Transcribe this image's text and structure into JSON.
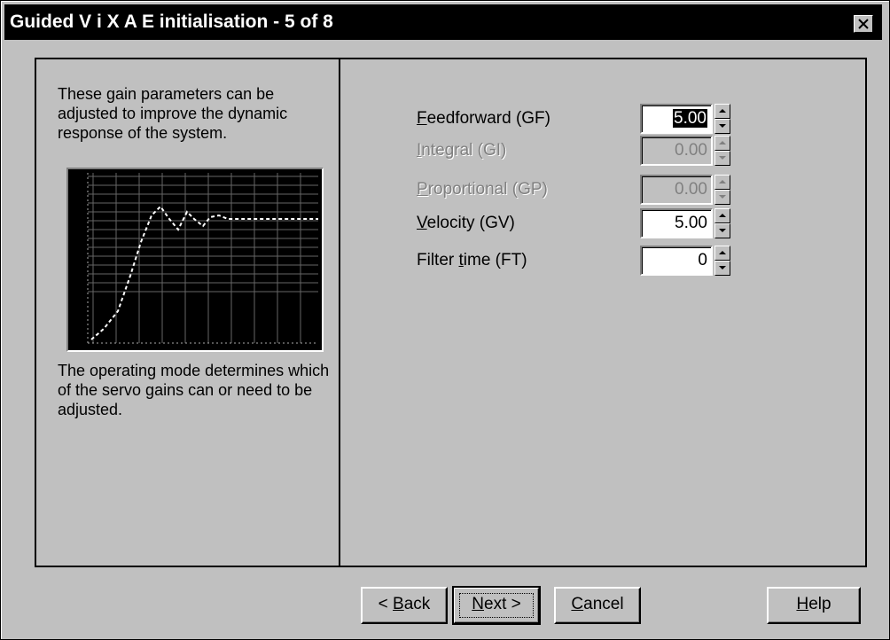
{
  "window": {
    "title": "Guided V i X A E initialisation - 5 of 8",
    "close_label": "×"
  },
  "left_panel": {
    "description_top": "These gain parameters can be adjusted to improve the dynamic response of the system.",
    "description_bottom": "The operating mode determines which of the servo gains can or need to be adjusted."
  },
  "parameters": [
    {
      "label_prefix": "",
      "mnemonic": "F",
      "label_suffix": "eedforward (GF)",
      "value": "5.00",
      "enabled": true,
      "selected": true
    },
    {
      "label_prefix": "",
      "mnemonic": "I",
      "label_suffix": "ntegral (GI)",
      "value": "0.00",
      "enabled": false,
      "selected": false
    },
    {
      "label_prefix": "",
      "mnemonic": "P",
      "label_suffix": "roportional (GP)",
      "value": "0.00",
      "enabled": false,
      "selected": false
    },
    {
      "label_prefix": "",
      "mnemonic": "V",
      "label_suffix": "elocity (GV)",
      "value": "5.00",
      "enabled": true,
      "selected": false
    },
    {
      "label_prefix": "Filter ",
      "mnemonic": "t",
      "label_suffix": "ime (FT)",
      "value": "0",
      "enabled": true,
      "selected": false
    }
  ],
  "buttons": {
    "back": {
      "prefix": "< ",
      "mnemonic": "B",
      "suffix": "ack"
    },
    "next": {
      "prefix": "",
      "mnemonic": "N",
      "suffix": "ext >"
    },
    "cancel": {
      "prefix": "",
      "mnemonic": "C",
      "suffix": "ancel"
    },
    "help": {
      "prefix": "",
      "mnemonic": "H",
      "suffix": "elp"
    }
  },
  "colors": {
    "face": "#c0c0c0",
    "title_bg": "#000000",
    "graph_bg": "#000000",
    "disabled_text": "#808080"
  }
}
